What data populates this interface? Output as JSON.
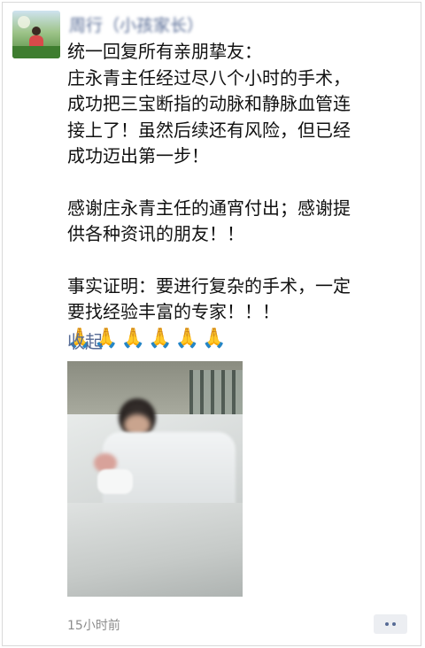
{
  "post": {
    "author": "周行（小孩家长）",
    "lines": [
      "统一回复所有亲朋挚友：",
      "庄永青主任经过尽八个小时的手术，",
      "成功把三宝断指的动脉和静脉血管连",
      "接上了！虽然后续还有风险，但已经",
      "成功迈出第一步！",
      "",
      "感谢庄永青主任的通宵付出；感谢提",
      "供各种资讯的朋友！！",
      "",
      "事实证明：要进行复杂的手术，一定",
      "要找经验丰富的专家！！！"
    ],
    "emoji": [
      "🙏",
      "🙏",
      "🙏",
      "🙏",
      "🙏",
      "🙏"
    ],
    "collapse_label": "收起",
    "timestamp": "15小时前",
    "photo_icon": "hospital-bed-photo"
  },
  "colors": {
    "link": "#576b95",
    "text": "#111111",
    "timestamp": "#8c8c8c"
  }
}
